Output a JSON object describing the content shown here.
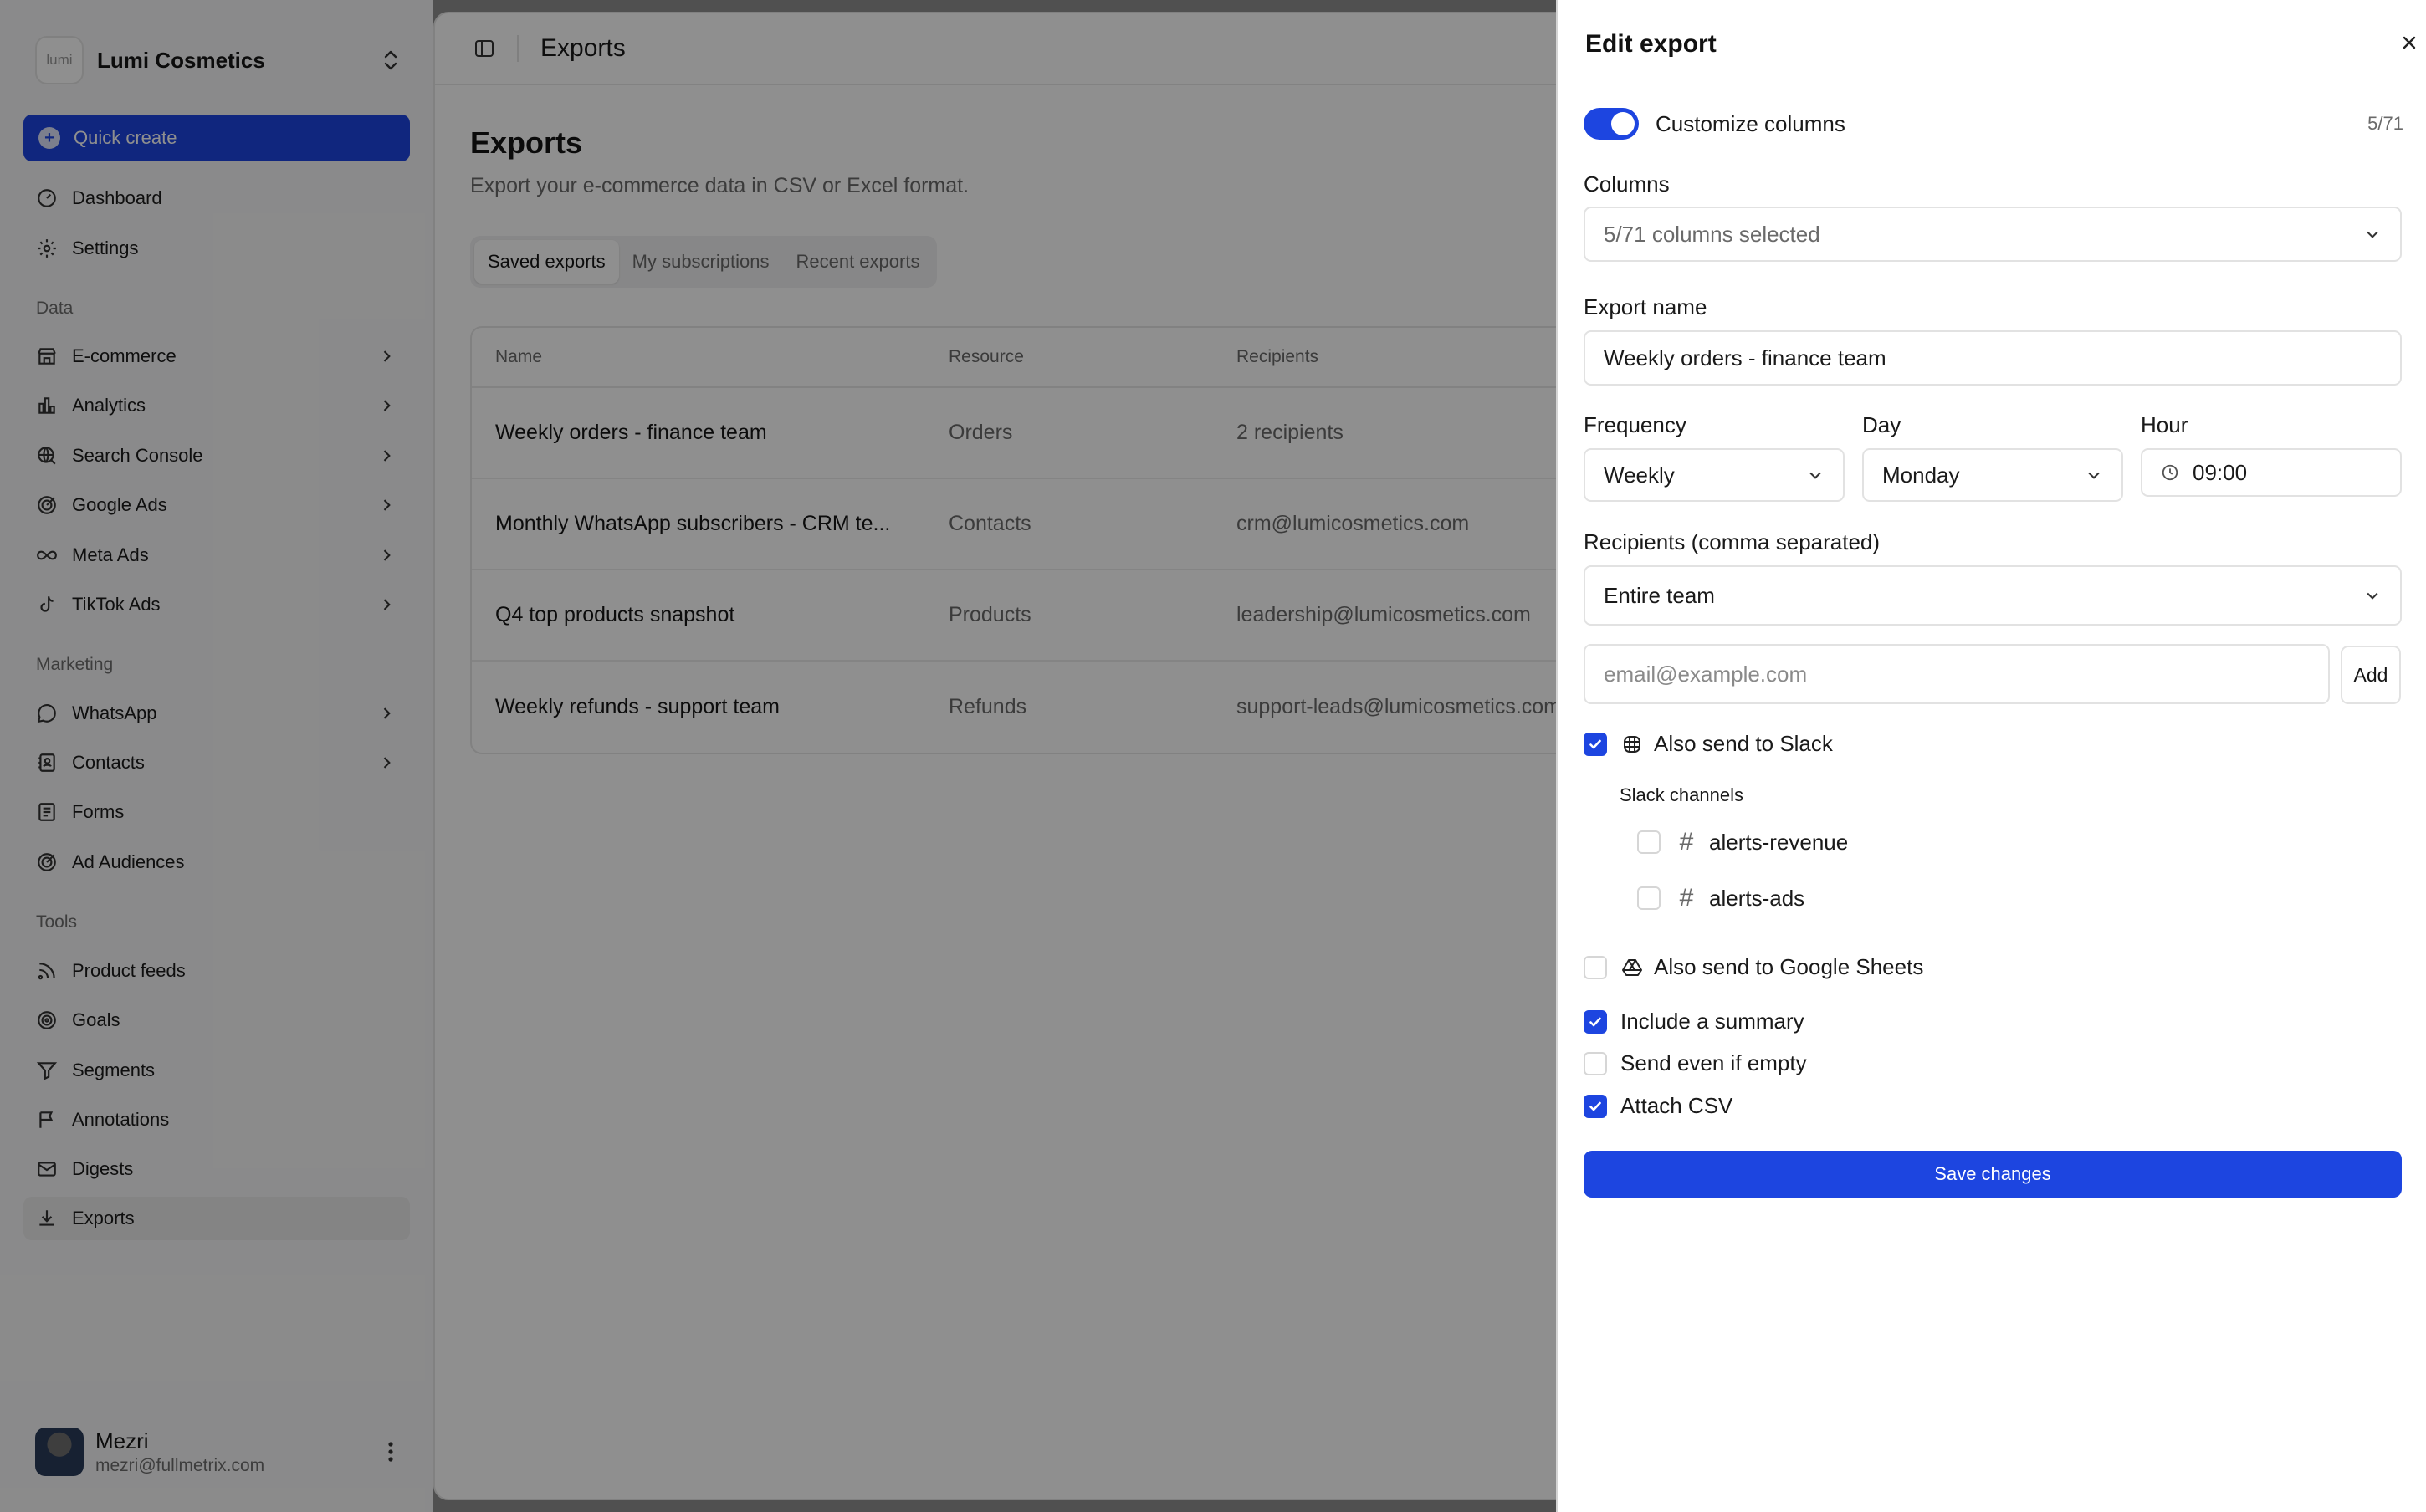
{
  "workspace": {
    "logo_text": "lumi",
    "name": "Lumi Cosmetics"
  },
  "sidebar": {
    "quick_create": "Quick create",
    "top_items": [
      {
        "label": "Dashboard",
        "icon": "gauge-icon"
      },
      {
        "label": "Settings",
        "icon": "gear-icon"
      }
    ],
    "sections": [
      {
        "label": "Data",
        "items": [
          {
            "label": "E-commerce",
            "icon": "store-icon",
            "has_children": true
          },
          {
            "label": "Analytics",
            "icon": "bar-chart-icon",
            "has_children": true
          },
          {
            "label": "Search Console",
            "icon": "search-globe-icon",
            "has_children": true
          },
          {
            "label": "Google Ads",
            "icon": "target-arrow-icon",
            "has_children": true
          },
          {
            "label": "Meta Ads",
            "icon": "infinity-icon",
            "has_children": true
          },
          {
            "label": "TikTok Ads",
            "icon": "music-note-icon",
            "has_children": true
          }
        ]
      },
      {
        "label": "Marketing",
        "items": [
          {
            "label": "WhatsApp",
            "icon": "chat-bubble-icon",
            "has_children": true
          },
          {
            "label": "Contacts",
            "icon": "contact-book-icon",
            "has_children": true
          },
          {
            "label": "Forms",
            "icon": "form-icon",
            "has_children": false
          },
          {
            "label": "Ad Audiences",
            "icon": "target-arrow-icon",
            "has_children": false
          }
        ]
      },
      {
        "label": "Tools",
        "items": [
          {
            "label": "Product feeds",
            "icon": "rss-icon",
            "has_children": false
          },
          {
            "label": "Goals",
            "icon": "target-icon",
            "has_children": false
          },
          {
            "label": "Segments",
            "icon": "funnel-icon",
            "has_children": false
          },
          {
            "label": "Annotations",
            "icon": "flag-icon",
            "has_children": false
          },
          {
            "label": "Digests",
            "icon": "mail-icon",
            "has_children": false
          },
          {
            "label": "Exports",
            "icon": "download-icon",
            "has_children": false,
            "active": true
          }
        ]
      }
    ],
    "user": {
      "name": "Mezri",
      "email": "mezri@fullmetrix.com"
    }
  },
  "header": {
    "breadcrumb": "Exports"
  },
  "page": {
    "title": "Exports",
    "subtitle": "Export your e-commerce data in CSV or Excel format.",
    "tabs": [
      {
        "label": "Saved exports",
        "active": true
      },
      {
        "label": "My subscriptions",
        "active": false
      },
      {
        "label": "Recent exports",
        "active": false
      }
    ],
    "table": {
      "columns": [
        "Name",
        "Resource",
        "Recipients"
      ],
      "rows": [
        {
          "name": "Weekly orders - finance team",
          "resource": "Orders",
          "recipients": "2 recipients"
        },
        {
          "name": "Monthly WhatsApp subscribers - CRM te...",
          "resource": "Contacts",
          "recipients": "crm@lumicosmetics.com"
        },
        {
          "name": "Q4 top products snapshot",
          "resource": "Products",
          "recipients": "leadership@lumicosmetics.com"
        },
        {
          "name": "Weekly refunds - support team",
          "resource": "Refunds",
          "recipients": "support-leads@lumicosmetics.com"
        }
      ]
    }
  },
  "sheet": {
    "title": "Edit export",
    "customize_columns": {
      "label": "Customize columns",
      "on": true,
      "count": "5/71"
    },
    "columns": {
      "label": "Columns",
      "value": "5/71 columns selected"
    },
    "export_name": {
      "label": "Export name",
      "value": "Weekly orders - finance team"
    },
    "frequency": {
      "label": "Frequency",
      "value": "Weekly"
    },
    "day": {
      "label": "Day",
      "value": "Monday"
    },
    "hour": {
      "label": "Hour",
      "value": "09:00"
    },
    "recipients": {
      "label": "Recipients (comma separated)",
      "value": "Entire team",
      "email_placeholder": "email@example.com",
      "add_label": "Add"
    },
    "slack": {
      "label": "Also send to Slack",
      "checked": true,
      "channels_label": "Slack channels",
      "channels": [
        {
          "name": "alerts-revenue",
          "checked": false
        },
        {
          "name": "alerts-ads",
          "checked": false
        }
      ]
    },
    "google_sheets": {
      "label": "Also send to Google Sheets",
      "checked": false
    },
    "options": [
      {
        "label": "Include a summary",
        "checked": true
      },
      {
        "label": "Send even if empty",
        "checked": false
      },
      {
        "label": "Attach CSV",
        "checked": true
      }
    ],
    "save_label": "Save changes"
  },
  "colors": {
    "accent": "#1d45e0",
    "overlay": "rgba(0,0,0,0.44)"
  }
}
